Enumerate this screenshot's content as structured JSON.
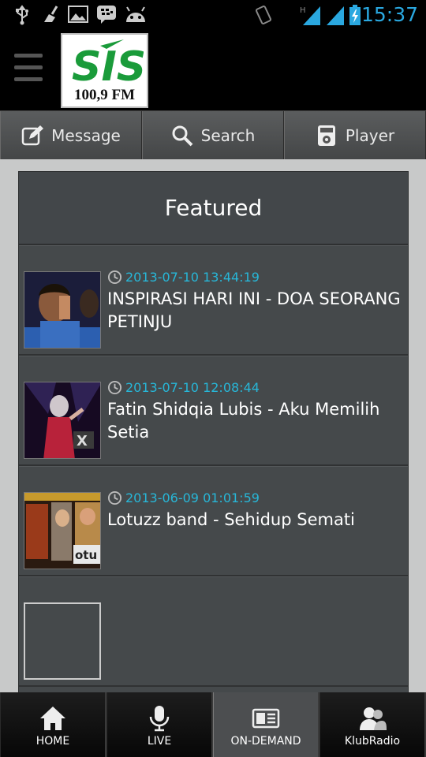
{
  "status_bar": {
    "time": "15:37",
    "left_icons": [
      "usb-icon",
      "clean-icon",
      "image-icon",
      "bbm-icon",
      "android-icon"
    ],
    "right_icons": [
      "vibrate-icon",
      "signal-h-icon",
      "signal-icon",
      "battery-charging-icon"
    ]
  },
  "header": {
    "logo_text": "100,9 FM",
    "logo_brand": "SIS",
    "menu_icon": "hamburger-icon"
  },
  "toolbar": {
    "message_label": "Message",
    "search_label": "Search",
    "player_label": "Player"
  },
  "featured": {
    "header": "Featured",
    "items": [
      {
        "date": "2013-07-10 13:44:19",
        "title": "INSPIRASI HARI INI - DOA SEORANG PETINJU"
      },
      {
        "date": "2013-07-10 12:08:44",
        "title": "Fatin Shidqia Lubis - Aku Memilih Setia"
      },
      {
        "date": "2013-06-09 01:01:59",
        "title": "Lotuzz band - Sehidup Semati"
      }
    ]
  },
  "bottom_nav": {
    "home": "HOME",
    "live": "LIVE",
    "on_demand": "ON-DEMAND",
    "klub": "KlubRadio",
    "active": "ON-DEMAND"
  },
  "colors": {
    "accent_blue": "#2aa8e0",
    "date_cyan": "#27b7d8",
    "logo_green": "#1a9b3a"
  }
}
